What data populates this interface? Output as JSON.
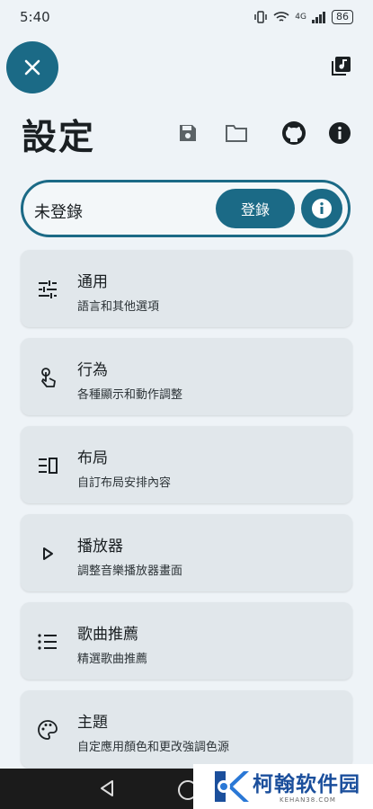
{
  "status_bar": {
    "time": "5:40",
    "network": "4G",
    "battery": "86"
  },
  "header": {
    "title": "設定"
  },
  "account": {
    "status": "未登錄",
    "login_label": "登錄"
  },
  "menu": [
    {
      "title": "通用",
      "subtitle": "語言和其他選項",
      "icon": "tune-icon"
    },
    {
      "title": "行為",
      "subtitle": "各種顯示和動作調整",
      "icon": "touch-icon"
    },
    {
      "title": "布局",
      "subtitle": "自訂布局安排內容",
      "icon": "layout-icon"
    },
    {
      "title": "播放器",
      "subtitle": "調整音樂播放器畫面",
      "icon": "play-icon"
    },
    {
      "title": "歌曲推薦",
      "subtitle": "精選歌曲推薦",
      "icon": "list-icon"
    },
    {
      "title": "主題",
      "subtitle": "自定應用顏色和更改強調色源",
      "icon": "palette-icon"
    }
  ],
  "watermark": {
    "name": "柯翰软件园",
    "url": "KEHAN38.COM"
  },
  "colors": {
    "accent": "#1b6a86",
    "background": "#eef3f7",
    "card": "#e1e7eb"
  }
}
